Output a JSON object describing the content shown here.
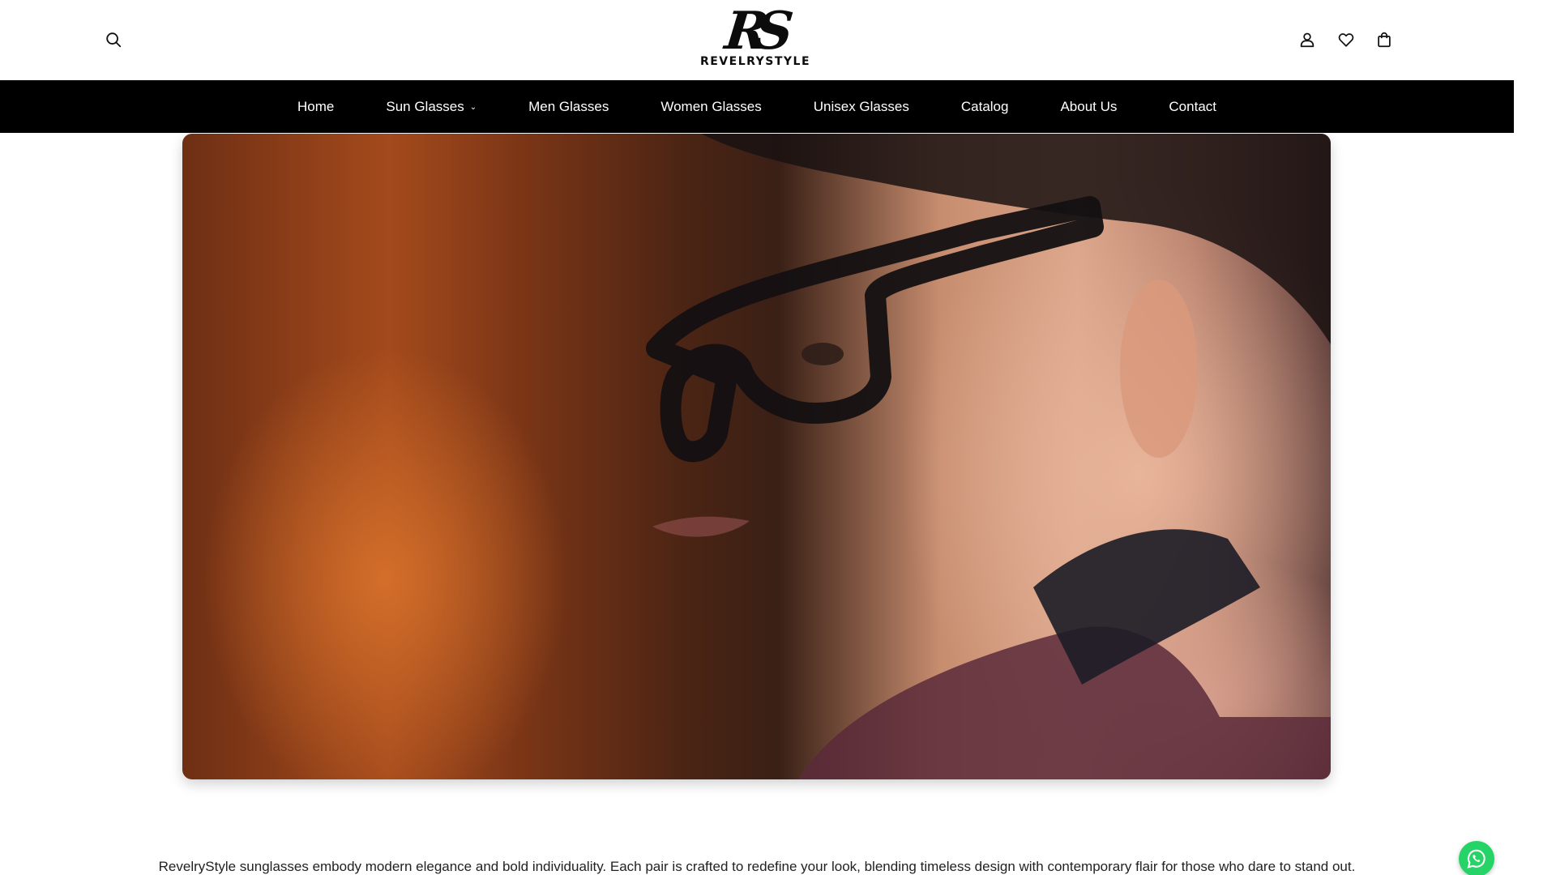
{
  "header": {
    "logo": {
      "mark": "RS",
      "text": "REVELRYSTYLE"
    },
    "icons": [
      "search-icon",
      "account-icon",
      "heart-icon",
      "shopping-bag-icon"
    ]
  },
  "nav": {
    "items": [
      {
        "label": "Home"
      },
      {
        "label": "Sun Glasses",
        "has_dropdown": true
      },
      {
        "label": "Men Glasses"
      },
      {
        "label": "Women Glasses"
      },
      {
        "label": "Unisex Glasses"
      },
      {
        "label": "Catalog"
      },
      {
        "label": "About Us"
      },
      {
        "label": "Contact"
      }
    ]
  },
  "tagline": "RevelryStyle sunglasses embody modern elegance and bold individuality. Each pair is crafted to redefine your look, blending timeless design with contemporary flair for those who dare to stand out.",
  "floating": {
    "icon": "whatsapp-icon",
    "color": "#25d366"
  },
  "colors": {
    "nav_bg": "#000000",
    "nav_text": "#ffffff",
    "page_bg": "#ffffff"
  }
}
